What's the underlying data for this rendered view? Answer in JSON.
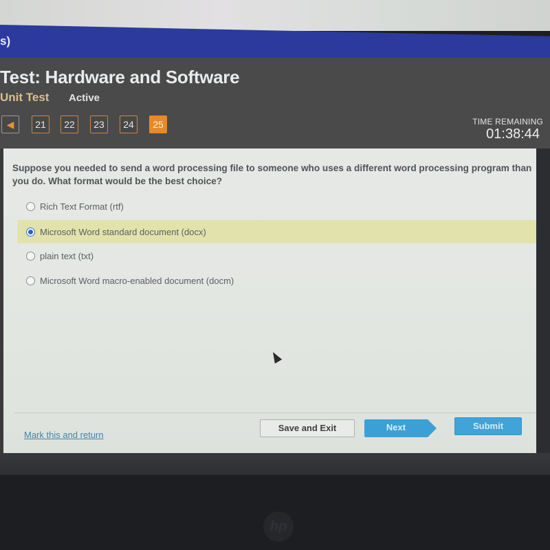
{
  "topbar": {
    "breadcrumb_fragment": "s)"
  },
  "header": {
    "title": "Test: Hardware and Software",
    "test_type": "Unit Test",
    "status": "Active"
  },
  "question_nav": {
    "prev_icon": "triangle-left-icon",
    "questions": [
      {
        "number": "21",
        "current": false
      },
      {
        "number": "22",
        "current": false
      },
      {
        "number": "23",
        "current": false
      },
      {
        "number": "24",
        "current": false
      },
      {
        "number": "25",
        "current": true
      }
    ]
  },
  "timer": {
    "label": "TIME REMAINING",
    "value": "01:38:44"
  },
  "question": {
    "text": "Suppose you needed to send a word processing file to someone who uses a different word processing program than you do. What format would be the best choice?",
    "options": [
      {
        "label": "Rich Text Format (rtf)",
        "selected": false
      },
      {
        "label": "Microsoft Word standard document (docx)",
        "selected": true
      },
      {
        "label": "plain text (txt)",
        "selected": false
      },
      {
        "label": "Microsoft Word macro-enabled document (docm)",
        "selected": false
      }
    ]
  },
  "footer": {
    "mark_link": "Mark this and return",
    "save_exit": "Save and Exit",
    "next": "Next",
    "submit": "Submit"
  },
  "colors": {
    "accent_orange": "#e8892a",
    "button_blue": "#3c9fd6",
    "selected_highlight": "#e2e2ac",
    "header_bar": "#2b3a9c"
  },
  "bezel": {
    "logo_icon": "hp-logo-icon",
    "logo_text": "hp"
  }
}
